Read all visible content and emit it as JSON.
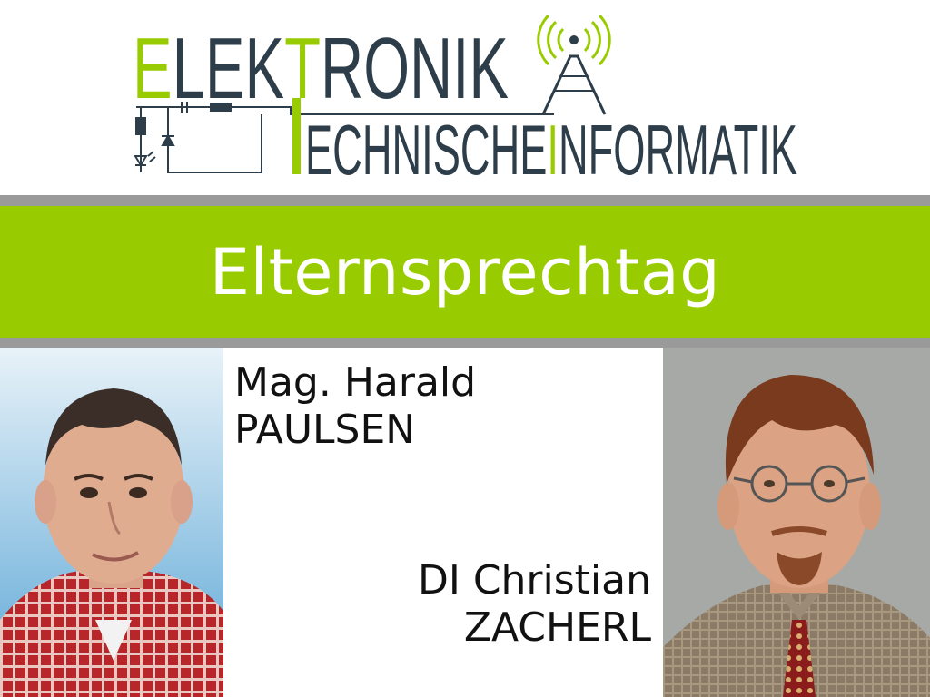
{
  "logo": {
    "line1_accent": "E",
    "line1_rest_a": "LEK",
    "line1_accent_2": "T",
    "line1_rest_b": "RONIK",
    "line2_a": "ECHNISCHE",
    "line2_accent": "I",
    "line2_b": "NFORMATIK"
  },
  "banner": {
    "title": "Elternsprechtag"
  },
  "teacher_1": {
    "title_first": "Mag. Harald",
    "last": "PAULSEN"
  },
  "teacher_2": {
    "title_first": "DI Christian",
    "last": "ZACHERL"
  },
  "colors": {
    "accent_green": "#99cc00",
    "logo_dark": "#2d3e4a",
    "divider_grey": "#9a9a9a"
  }
}
